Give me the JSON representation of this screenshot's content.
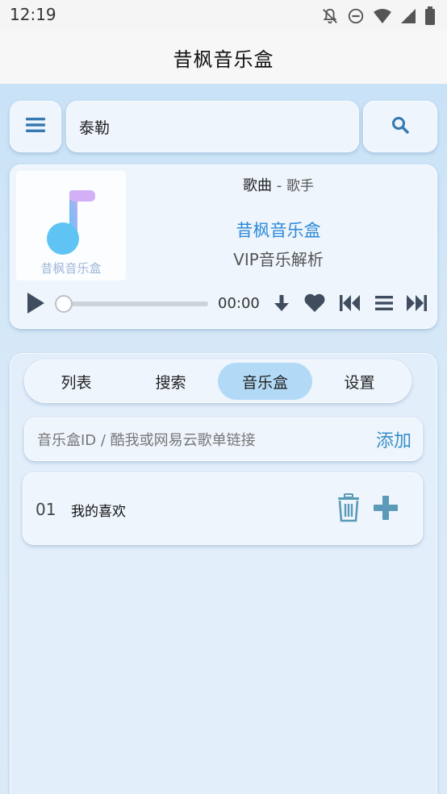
{
  "status_bar": {
    "time": "12:19"
  },
  "app": {
    "title": "昔枫音乐盒"
  },
  "search": {
    "value": "泰勒"
  },
  "player": {
    "cover_label": "昔枫音乐盒",
    "song": "歌曲",
    "separator": " - ",
    "singer": "歌手",
    "album_line1": "昔枫音乐盒",
    "album_line2": "VIP音乐解析",
    "current_time": "00:00",
    "progress": 0
  },
  "tabs": [
    {
      "label": "列表",
      "active": false
    },
    {
      "label": "搜索",
      "active": false
    },
    {
      "label": "音乐盒",
      "active": true
    },
    {
      "label": "设置",
      "active": false
    }
  ],
  "add_box": {
    "placeholder": "音乐盒ID / 酷我或网易云歌单链接",
    "button_label": "添加"
  },
  "playlists": [
    {
      "index": "01",
      "name": "我的喜欢"
    }
  ],
  "colors": {
    "accent": "#3a8fc4",
    "active_tab": "#b2daf7",
    "icon_dark": "#3f4d5e",
    "icon_teal": "#5b9bb8"
  }
}
